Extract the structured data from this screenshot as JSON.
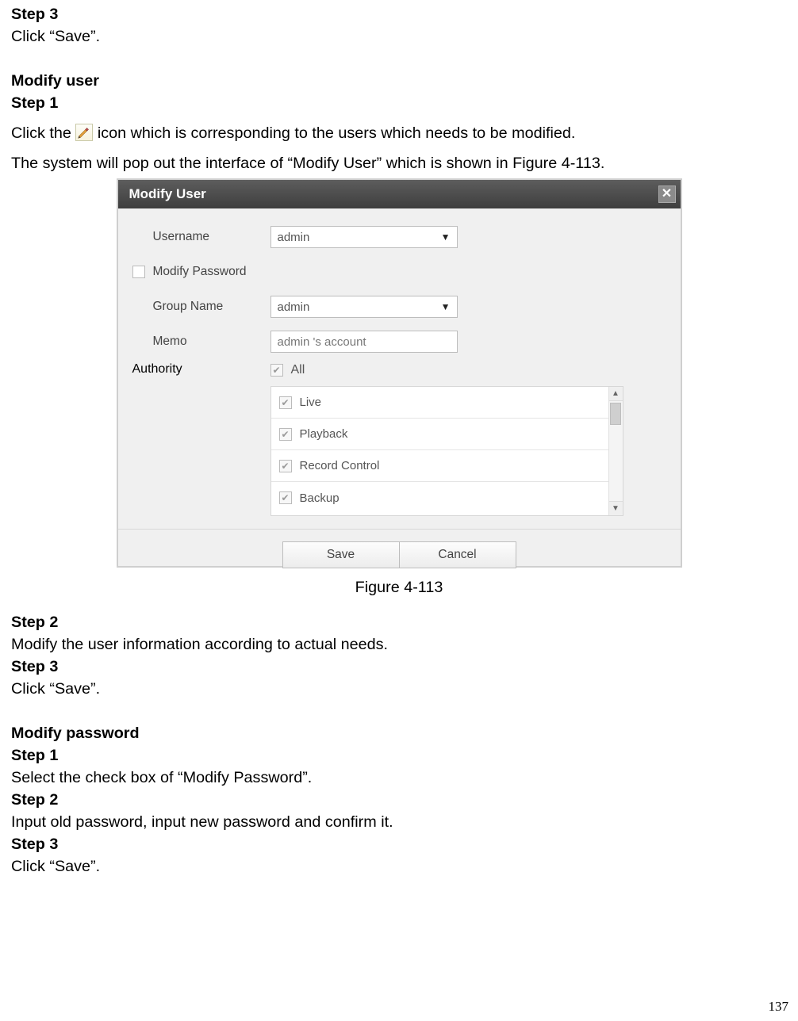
{
  "top": {
    "step3": "Step 3",
    "click_save": "Click “Save”."
  },
  "modify_user_heading": "Modify user",
  "mu_step1": "Step 1",
  "mu_click_the": "Click the ",
  "mu_click_the_tail": " icon which is corresponding to the users which needs to be modified.",
  "mu_popup_line": "The system will pop out the interface of “Modify User” which is shown in Figure 4-113.",
  "dialog": {
    "title": "Modify User",
    "username_label": "Username",
    "username_value": "admin",
    "modify_pw_label": "Modify Password",
    "group_label": "Group Name",
    "group_value": "admin",
    "memo_label": "Memo",
    "memo_value": "admin 's  account",
    "authority_label": "Authority",
    "all_label": "All",
    "items": {
      "0": "Live",
      "1": "Playback",
      "2": "Record Control",
      "3": "Backup"
    },
    "save": "Save",
    "cancel": "Cancel"
  },
  "caption": "Figure 4-113",
  "step2_h": "Step 2",
  "step2_t": "Modify the user information according to actual needs.",
  "step3_h": "Step 3",
  "step3_t": "Click “Save”.",
  "mp_heading": "Modify password",
  "mp_s1": "Step 1",
  "mp_s1_t": "Select the check box of “Modify Password”.",
  "mp_s2": "Step 2",
  "mp_s2_t": "Input old password, input new password and confirm it.",
  "mp_s3": "Step 3",
  "mp_s3_t": "Click “Save”.",
  "page_number": "137"
}
